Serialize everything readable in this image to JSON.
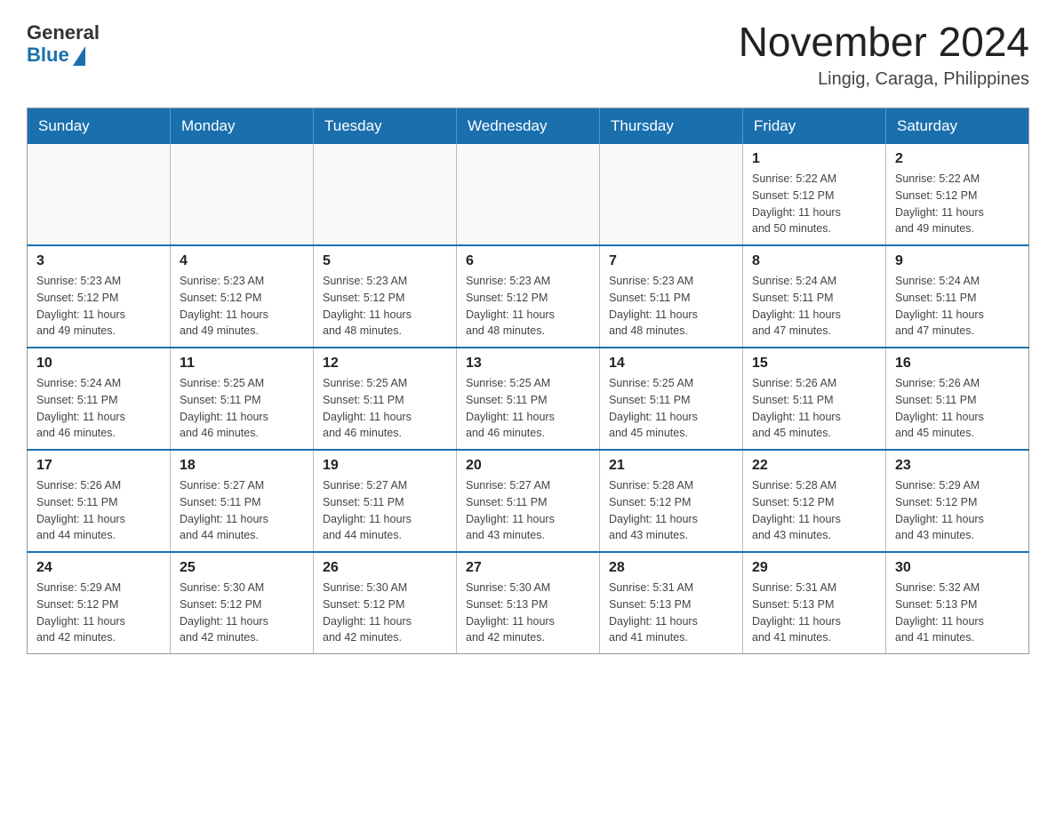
{
  "logo": {
    "general": "General",
    "blue": "Blue"
  },
  "title": "November 2024",
  "subtitle": "Lingig, Caraga, Philippines",
  "weekdays": [
    "Sunday",
    "Monday",
    "Tuesday",
    "Wednesday",
    "Thursday",
    "Friday",
    "Saturday"
  ],
  "weeks": [
    [
      {
        "day": "",
        "info": ""
      },
      {
        "day": "",
        "info": ""
      },
      {
        "day": "",
        "info": ""
      },
      {
        "day": "",
        "info": ""
      },
      {
        "day": "",
        "info": ""
      },
      {
        "day": "1",
        "info": "Sunrise: 5:22 AM\nSunset: 5:12 PM\nDaylight: 11 hours\nand 50 minutes."
      },
      {
        "day": "2",
        "info": "Sunrise: 5:22 AM\nSunset: 5:12 PM\nDaylight: 11 hours\nand 49 minutes."
      }
    ],
    [
      {
        "day": "3",
        "info": "Sunrise: 5:23 AM\nSunset: 5:12 PM\nDaylight: 11 hours\nand 49 minutes."
      },
      {
        "day": "4",
        "info": "Sunrise: 5:23 AM\nSunset: 5:12 PM\nDaylight: 11 hours\nand 49 minutes."
      },
      {
        "day": "5",
        "info": "Sunrise: 5:23 AM\nSunset: 5:12 PM\nDaylight: 11 hours\nand 48 minutes."
      },
      {
        "day": "6",
        "info": "Sunrise: 5:23 AM\nSunset: 5:12 PM\nDaylight: 11 hours\nand 48 minutes."
      },
      {
        "day": "7",
        "info": "Sunrise: 5:23 AM\nSunset: 5:11 PM\nDaylight: 11 hours\nand 48 minutes."
      },
      {
        "day": "8",
        "info": "Sunrise: 5:24 AM\nSunset: 5:11 PM\nDaylight: 11 hours\nand 47 minutes."
      },
      {
        "day": "9",
        "info": "Sunrise: 5:24 AM\nSunset: 5:11 PM\nDaylight: 11 hours\nand 47 minutes."
      }
    ],
    [
      {
        "day": "10",
        "info": "Sunrise: 5:24 AM\nSunset: 5:11 PM\nDaylight: 11 hours\nand 46 minutes."
      },
      {
        "day": "11",
        "info": "Sunrise: 5:25 AM\nSunset: 5:11 PM\nDaylight: 11 hours\nand 46 minutes."
      },
      {
        "day": "12",
        "info": "Sunrise: 5:25 AM\nSunset: 5:11 PM\nDaylight: 11 hours\nand 46 minutes."
      },
      {
        "day": "13",
        "info": "Sunrise: 5:25 AM\nSunset: 5:11 PM\nDaylight: 11 hours\nand 46 minutes."
      },
      {
        "day": "14",
        "info": "Sunrise: 5:25 AM\nSunset: 5:11 PM\nDaylight: 11 hours\nand 45 minutes."
      },
      {
        "day": "15",
        "info": "Sunrise: 5:26 AM\nSunset: 5:11 PM\nDaylight: 11 hours\nand 45 minutes."
      },
      {
        "day": "16",
        "info": "Sunrise: 5:26 AM\nSunset: 5:11 PM\nDaylight: 11 hours\nand 45 minutes."
      }
    ],
    [
      {
        "day": "17",
        "info": "Sunrise: 5:26 AM\nSunset: 5:11 PM\nDaylight: 11 hours\nand 44 minutes."
      },
      {
        "day": "18",
        "info": "Sunrise: 5:27 AM\nSunset: 5:11 PM\nDaylight: 11 hours\nand 44 minutes."
      },
      {
        "day": "19",
        "info": "Sunrise: 5:27 AM\nSunset: 5:11 PM\nDaylight: 11 hours\nand 44 minutes."
      },
      {
        "day": "20",
        "info": "Sunrise: 5:27 AM\nSunset: 5:11 PM\nDaylight: 11 hours\nand 43 minutes."
      },
      {
        "day": "21",
        "info": "Sunrise: 5:28 AM\nSunset: 5:12 PM\nDaylight: 11 hours\nand 43 minutes."
      },
      {
        "day": "22",
        "info": "Sunrise: 5:28 AM\nSunset: 5:12 PM\nDaylight: 11 hours\nand 43 minutes."
      },
      {
        "day": "23",
        "info": "Sunrise: 5:29 AM\nSunset: 5:12 PM\nDaylight: 11 hours\nand 43 minutes."
      }
    ],
    [
      {
        "day": "24",
        "info": "Sunrise: 5:29 AM\nSunset: 5:12 PM\nDaylight: 11 hours\nand 42 minutes."
      },
      {
        "day": "25",
        "info": "Sunrise: 5:30 AM\nSunset: 5:12 PM\nDaylight: 11 hours\nand 42 minutes."
      },
      {
        "day": "26",
        "info": "Sunrise: 5:30 AM\nSunset: 5:12 PM\nDaylight: 11 hours\nand 42 minutes."
      },
      {
        "day": "27",
        "info": "Sunrise: 5:30 AM\nSunset: 5:13 PM\nDaylight: 11 hours\nand 42 minutes."
      },
      {
        "day": "28",
        "info": "Sunrise: 5:31 AM\nSunset: 5:13 PM\nDaylight: 11 hours\nand 41 minutes."
      },
      {
        "day": "29",
        "info": "Sunrise: 5:31 AM\nSunset: 5:13 PM\nDaylight: 11 hours\nand 41 minutes."
      },
      {
        "day": "30",
        "info": "Sunrise: 5:32 AM\nSunset: 5:13 PM\nDaylight: 11 hours\nand 41 minutes."
      }
    ]
  ]
}
